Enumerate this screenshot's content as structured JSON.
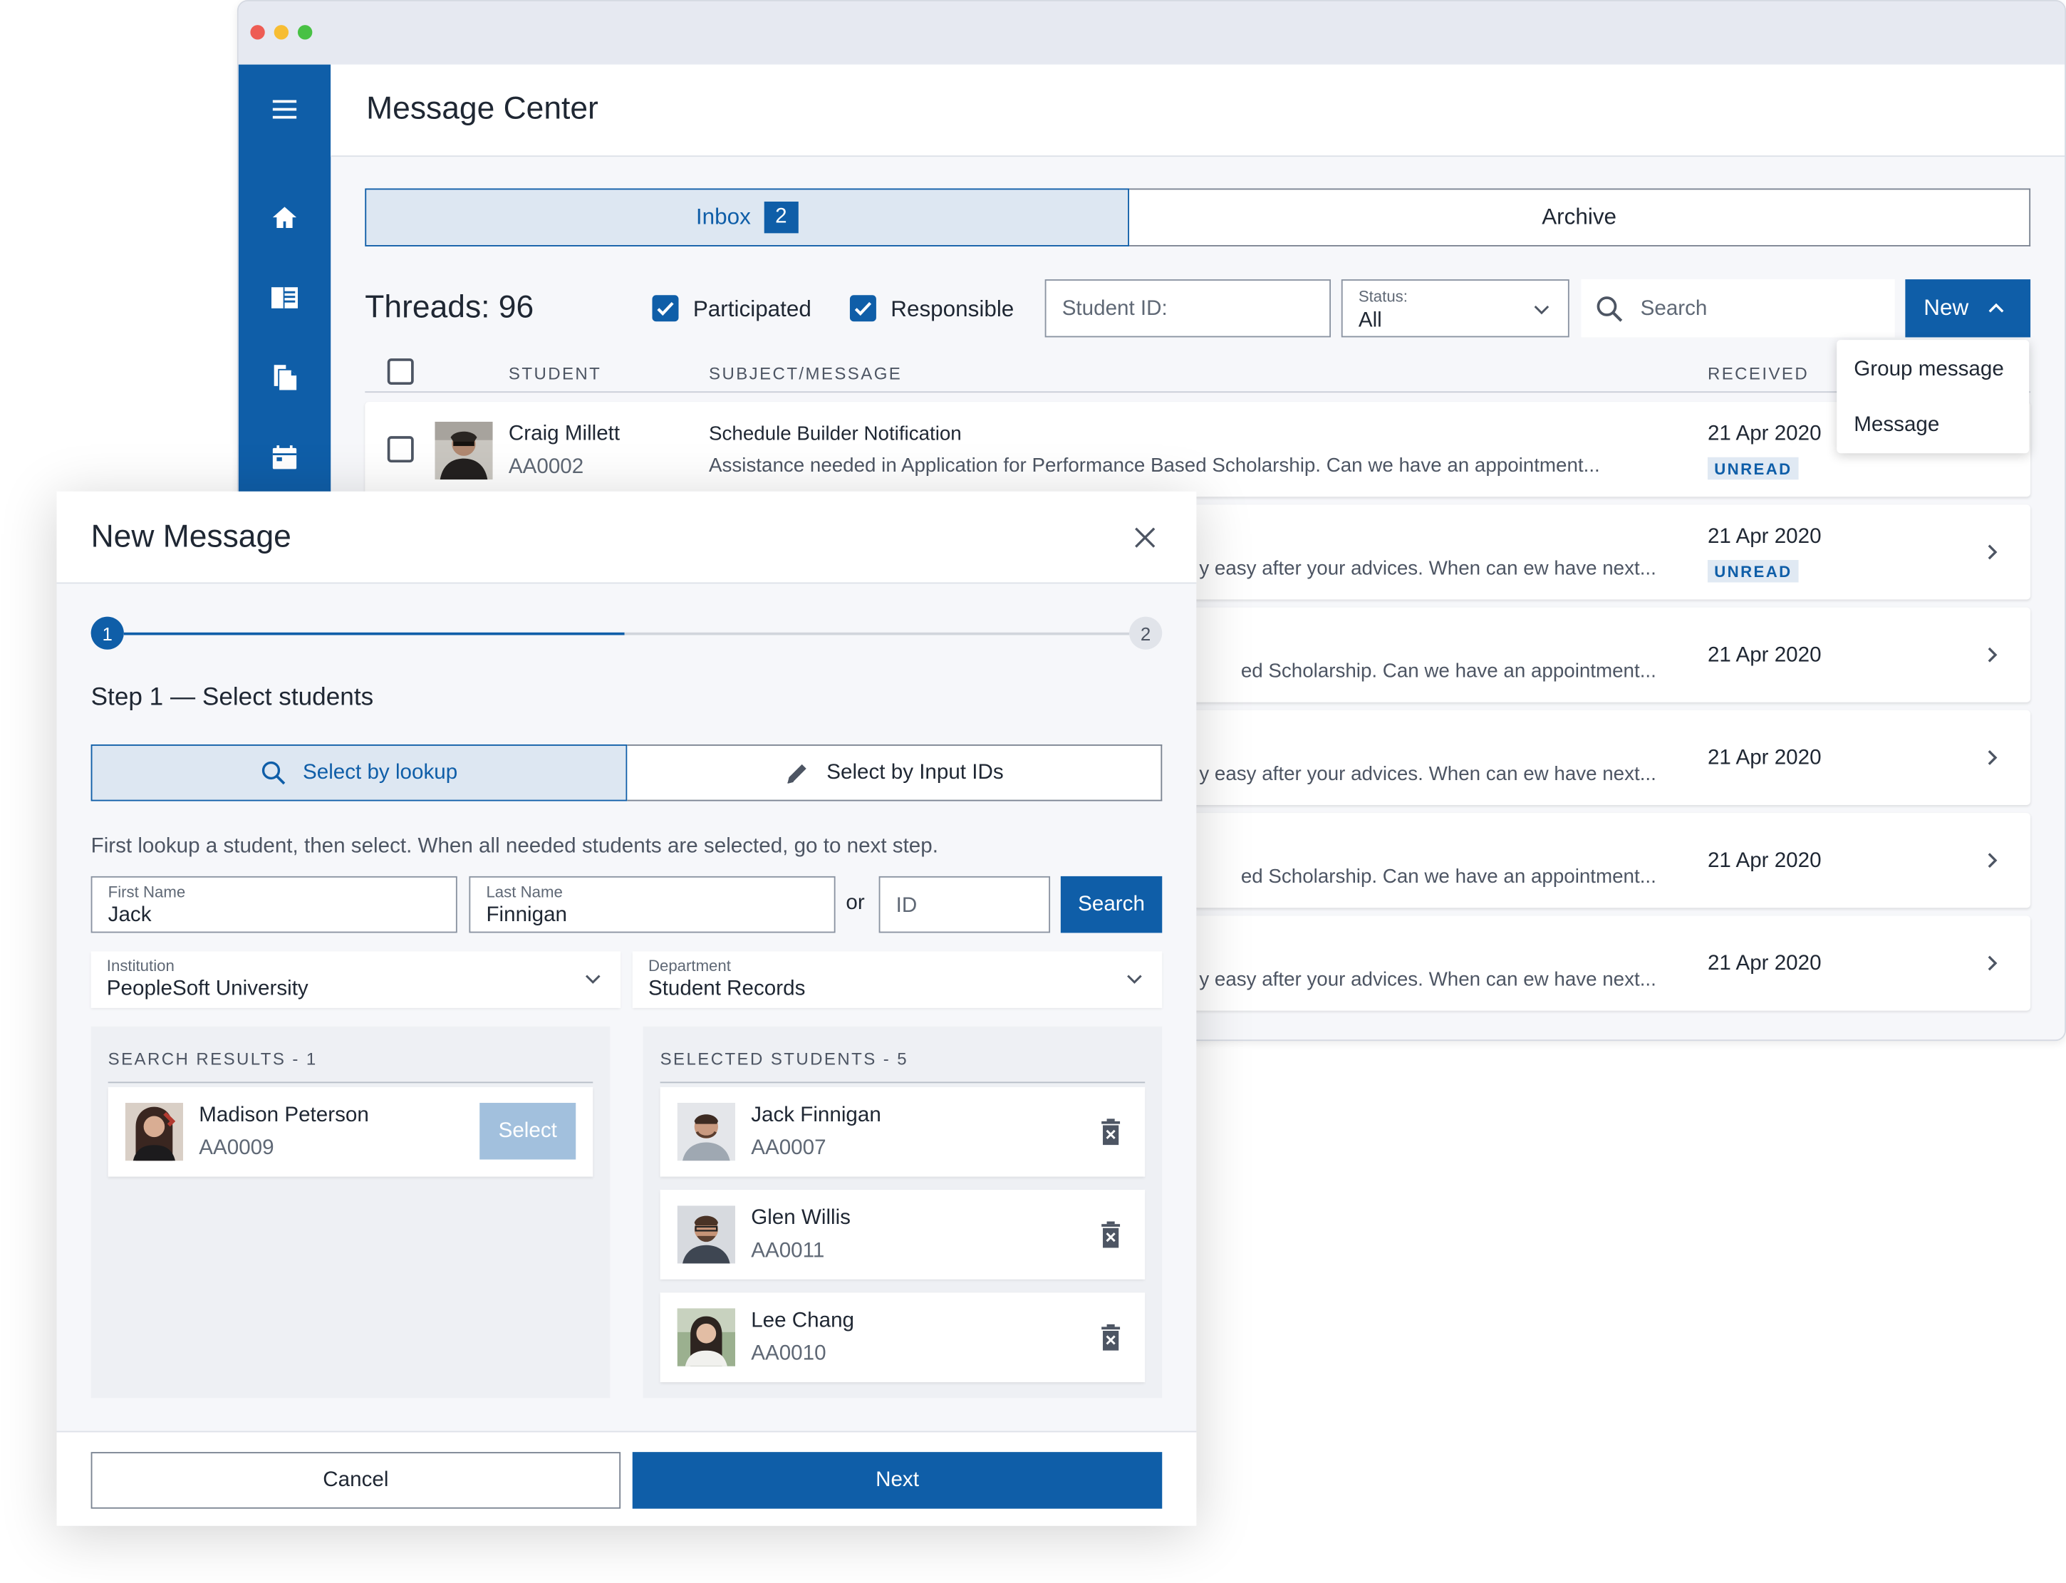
{
  "colors": {
    "primary": "#0f5ea8",
    "unread_bg": "#e0e9f3",
    "disabled_button": "#a2c0dd"
  },
  "window": {
    "title": "Message Center",
    "rail_icons": [
      "menu-icon",
      "home-icon",
      "catalog-icon",
      "documents-icon",
      "calendar-icon"
    ]
  },
  "tabs": [
    {
      "label": "Inbox",
      "badge": "2",
      "active": true
    },
    {
      "label": "Archive",
      "active": false
    }
  ],
  "toolbar": {
    "threads": "Threads: 96",
    "participated_label": "Participated",
    "participated_checked": true,
    "responsible_label": "Responsible",
    "responsible_checked": true,
    "student_id_placeholder": "Student ID:",
    "status_label": "Status:",
    "status_value": "All",
    "search_placeholder": "Search",
    "new_label": "New"
  },
  "new_menu": {
    "items": [
      "Group message",
      "Message"
    ]
  },
  "table": {
    "columns": [
      "STUDENT",
      "SUBJECT/MESSAGE",
      "RECEIVED"
    ],
    "rows": [
      {
        "student_name": "Craig Millett",
        "student_id": "AA0002",
        "subject": "Schedule Builder Notification",
        "message": "Assistance needed in Application for Performance Based Scholarship. Can we have an appointment...",
        "date": "21 Apr 2020",
        "status": "UNREAD"
      },
      {
        "message": "y easy after your advices. When can ew have next...",
        "date": "21 Apr 2020",
        "status": "UNREAD"
      },
      {
        "message": "ed Scholarship. Can we have an appointment...",
        "date": "21 Apr 2020"
      },
      {
        "message": "y easy after your advices. When can ew have next...",
        "date": "21 Apr 2020"
      },
      {
        "message": "ed Scholarship. Can we have an appointment...",
        "date": "21 Apr 2020"
      },
      {
        "message": "y easy after your advices. When can ew have next...",
        "date": "21 Apr 2020"
      }
    ]
  },
  "modal": {
    "title": "New Message",
    "steps": [
      "1",
      "2"
    ],
    "step_title": "Step 1 — Select students",
    "mode_lookup": "Select by lookup",
    "mode_ids": "Select by Input IDs",
    "hint": "First lookup a student, then select. When all needed students are selected, go to next  step.",
    "first_name_label": "First Name",
    "first_name_value": "Jack",
    "last_name_label": "Last Name",
    "last_name_value": "Finnigan",
    "or_label": "or",
    "id_placeholder": "ID",
    "search_label": "Search",
    "institution_label": "Institution",
    "institution_value": "PeopleSoft University",
    "department_label": "Department",
    "department_value": "Student Records",
    "results_header": "SEARCH RESULTS - 1",
    "results": [
      {
        "name": "Madison Peterson",
        "id": "AA0009",
        "action": "Select"
      }
    ],
    "selected_header": "SELECTED STUDENTS - 5",
    "selected": [
      {
        "name": "Jack Finnigan",
        "id": "AA0007"
      },
      {
        "name": "Glen Willis",
        "id": "AA0011"
      },
      {
        "name": "Lee Chang",
        "id": "AA0010"
      }
    ],
    "cancel_label": "Cancel",
    "next_label": "Next"
  }
}
